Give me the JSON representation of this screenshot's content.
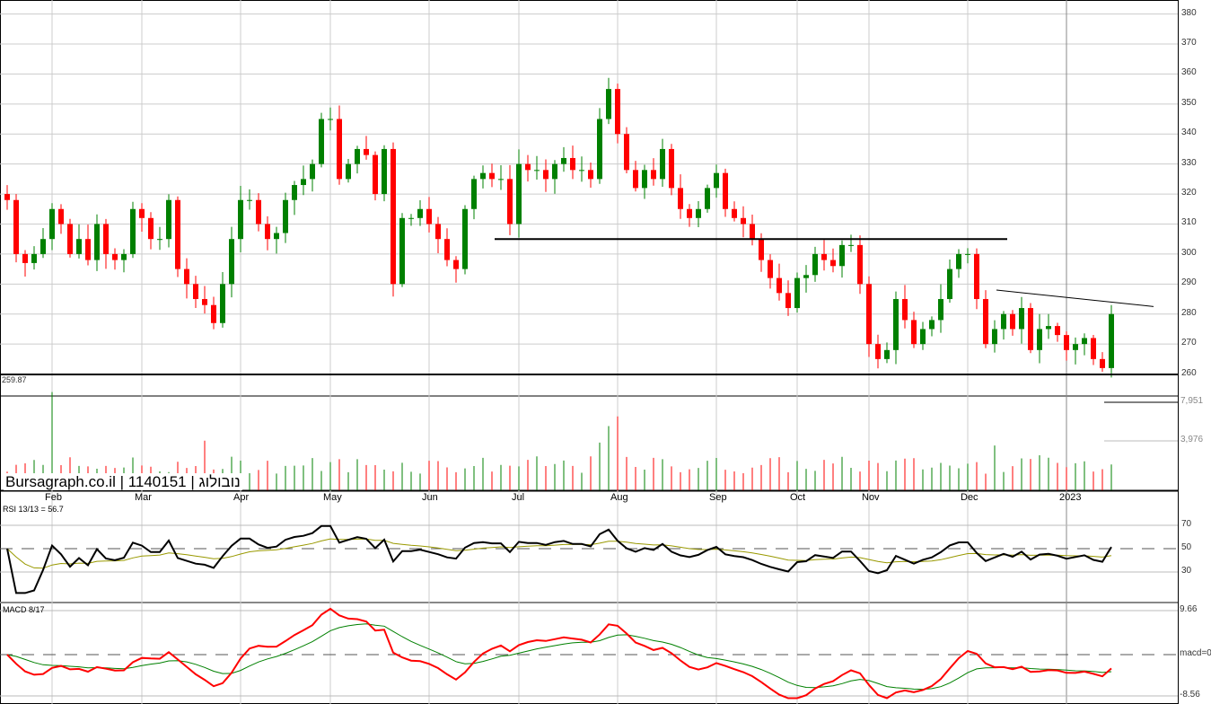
{
  "header": {
    "brand": "Bursagraph.co.il | 1140151 | נובולוג"
  },
  "chart_data": {
    "type": "candlestick",
    "title": "Bursagraph.co.il | 1140151 | נובולוג",
    "price_axis": {
      "ticks": [
        260,
        270,
        280,
        290,
        300,
        310,
        320,
        330,
        340,
        350,
        360,
        370,
        380
      ],
      "range": [
        258,
        382
      ]
    },
    "support_label": "259.87",
    "support_level": 259.87,
    "resistance_level": 305,
    "trendline": {
      "from": 288,
      "to": 282.5
    },
    "months": [
      "Feb",
      "Mar",
      "Apr",
      "May",
      "Jun",
      "Jul",
      "Aug",
      "Sep",
      "Oct",
      "Nov",
      "Dec",
      "2023"
    ],
    "month_index": [
      5,
      15,
      26,
      36,
      47,
      57,
      68,
      79,
      88,
      96,
      107,
      118
    ],
    "closes": [
      318,
      300,
      297,
      300,
      305,
      315,
      310,
      300,
      305,
      298,
      310,
      300,
      298,
      300,
      315,
      312,
      305,
      305,
      318,
      295,
      290,
      285,
      283,
      277,
      290,
      305,
      318,
      318,
      310,
      305,
      307,
      318,
      323,
      325,
      330,
      345,
      345,
      325,
      330,
      335,
      333,
      320,
      335,
      290,
      312,
      312,
      315,
      310,
      305,
      298,
      295,
      315,
      325,
      327,
      325,
      325,
      310,
      330,
      328,
      328,
      325,
      330,
      332,
      328,
      328,
      325,
      345,
      355,
      340,
      328,
      322,
      328,
      325,
      335,
      322,
      315,
      312,
      315,
      322,
      327,
      315,
      312,
      310,
      305,
      298,
      292,
      287,
      282,
      292,
      293,
      300,
      298,
      296,
      303,
      303,
      290,
      270,
      265,
      268,
      285,
      278,
      270,
      275,
      278,
      285,
      295,
      300,
      300,
      285,
      270,
      275,
      280,
      275,
      282,
      268,
      275,
      276,
      273,
      268,
      270,
      272,
      265,
      262,
      280
    ],
    "volume_axis": {
      "ticks": [
        "7,951",
        "3,976"
      ],
      "values": [
        7951,
        3976
      ]
    },
    "volume_spikes": {
      "5": 9000,
      "22": 4000,
      "66": 3800,
      "67": 5500,
      "68": 6500,
      "110": 3500,
      "115": 2500
    },
    "rsi": {
      "label": "RSI 13/13 = 56.7",
      "ticks": [
        "70",
        "50",
        "30"
      ],
      "values": [
        70,
        50,
        30
      ]
    },
    "macd": {
      "label": "MACD 8/17",
      "ticks": [
        "9.66",
        "macd=0",
        "-8.56"
      ],
      "values": [
        9.66,
        0,
        -8.56
      ]
    },
    "colors": {
      "up": "#008000",
      "down": "#ff0000",
      "rsi": "#000000",
      "signal": "#999900",
      "macd": "#ff0000",
      "macd_signal": "#008000"
    }
  }
}
